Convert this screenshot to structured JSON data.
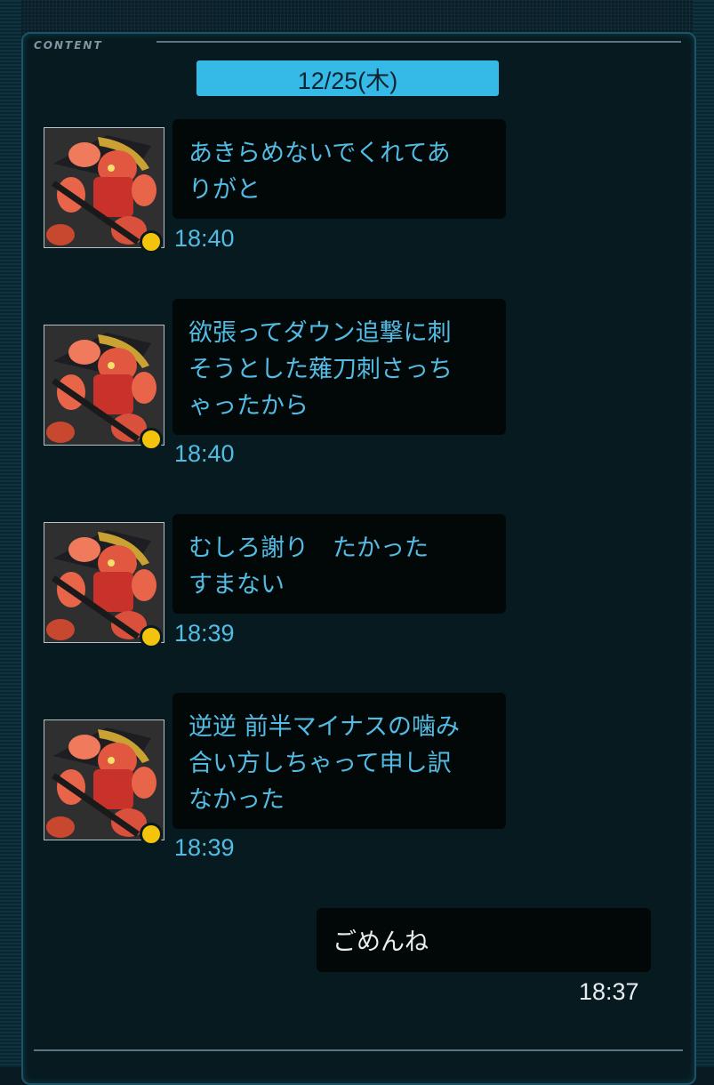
{
  "header": {
    "label": "CONTENT"
  },
  "date": "12/25(木)",
  "messages": [
    {
      "text": "あきらめないでくれてあ\nりがと",
      "time": "18:40",
      "sender": "other",
      "avatar": "robot-avatar-image",
      "status_color": "#f4c40c"
    },
    {
      "text": "欲張ってダウン追撃に刺\nそうとした薙刀刺さっち\nゃったから",
      "time": "18:40",
      "sender": "other",
      "avatar": "robot-avatar-image",
      "status_color": "#f4c40c"
    },
    {
      "text": "むしろ謝り　たかった\nすまない",
      "time": "18:39",
      "sender": "other",
      "avatar": "robot-avatar-image",
      "status_color": "#f4c40c"
    },
    {
      "text": "逆逆 前半マイナスの噛み\n合い方しちゃって申し訳\nなかった",
      "time": "18:39",
      "sender": "other",
      "avatar": "robot-avatar-image",
      "status_color": "#f4c40c"
    },
    {
      "text": "ごめんね",
      "time": "18:37",
      "sender": "self"
    }
  ],
  "colors": {
    "accent": "#35b9e6",
    "incoming_text": "#52bce4",
    "outgoing_text": "#e8eef0",
    "bubble_bg": "#020808",
    "status_online": "#f4c40c"
  }
}
